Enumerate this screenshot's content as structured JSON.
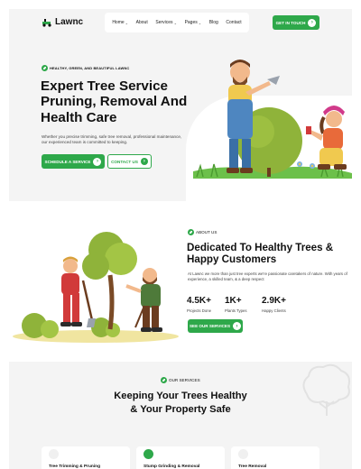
{
  "brand": {
    "name": "Lawnc",
    "accent": "#2ea84a"
  },
  "nav": {
    "items": [
      {
        "label": "Home",
        "has_dropdown": true
      },
      {
        "label": "About",
        "has_dropdown": false
      },
      {
        "label": "Services",
        "has_dropdown": true
      },
      {
        "label": "Pages",
        "has_dropdown": true
      },
      {
        "label": "Blog",
        "has_dropdown": false
      },
      {
        "label": "Contact",
        "has_dropdown": false
      }
    ],
    "cta_label": "GET IN TOUCH"
  },
  "hero": {
    "tagline": "HEALTHY, GREEN, AND BEAUTIFUL LAWNC",
    "title": "Expert Tree Service Pruning, Removal And Health Care",
    "description": "Whether you precise trimming, safe tree removal, professional maintenance, our experienced team is committed to keeping.",
    "primary_button": "SCHEDULE A SERVICE",
    "secondary_button": "CONTACT US"
  },
  "about": {
    "tag": "ABOUT US",
    "title": "Dedicated To Healthy Trees & Happy Customers",
    "description": "At Lawnc we more than just tree experts we're passionate caretakers of nature. With years of experience, a skilled team, & a deep respect",
    "stats": [
      {
        "value": "4.5K+",
        "label": "Projects Done"
      },
      {
        "value": "1K+",
        "label": "Plants Types"
      },
      {
        "value": "2.9K+",
        "label": "Happy Clients"
      }
    ],
    "button": "SEE OUR SERVICES"
  },
  "services": {
    "tag": "OUR SERVICES",
    "title": "Keeping Your Trees Healthy & Your Property Safe",
    "cards": [
      {
        "name": "Tree Trimming & Pruning"
      },
      {
        "name": "Stump Grinding & Removal"
      },
      {
        "name": "Tree Removal"
      }
    ]
  }
}
